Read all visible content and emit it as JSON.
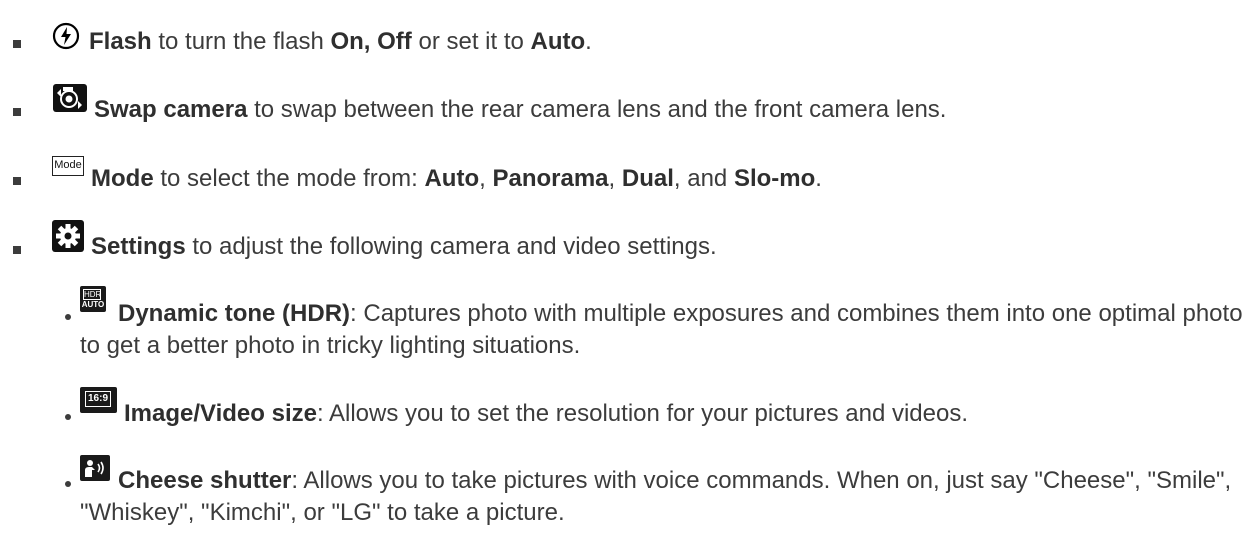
{
  "items": [
    {
      "icon": "flash-icon",
      "segments": [
        {
          "t": "Flash",
          "b": true
        },
        {
          "t": " to turn the flash ",
          "b": false
        },
        {
          "t": "On, Off",
          "b": true
        },
        {
          "t": " or set it to ",
          "b": false
        },
        {
          "t": "Auto",
          "b": true
        },
        {
          "t": ".",
          "b": false
        }
      ]
    },
    {
      "icon": "swap-camera-icon",
      "segments": [
        {
          "t": "Swap camera",
          "b": true
        },
        {
          "t": " to swap between the rear camera lens and the front camera lens.",
          "b": false
        }
      ]
    },
    {
      "icon": "mode-icon",
      "icon_label": "Mode",
      "segments": [
        {
          "t": "Mode",
          "b": true
        },
        {
          "t": " to select the mode from: ",
          "b": false
        },
        {
          "t": "Auto",
          "b": true
        },
        {
          "t": ", ",
          "b": false
        },
        {
          "t": "Panorama",
          "b": true
        },
        {
          "t": ", ",
          "b": false
        },
        {
          "t": "Dual",
          "b": true
        },
        {
          "t": ", and ",
          "b": false
        },
        {
          "t": "Slo-mo",
          "b": true
        },
        {
          "t": ".",
          "b": false
        }
      ]
    },
    {
      "icon": "gear-icon",
      "segments": [
        {
          "t": "Settings",
          "b": true
        },
        {
          "t": " to adjust the following camera and video settings.",
          "b": false
        }
      ]
    }
  ],
  "subitems": [
    {
      "icon": "hdr-auto-icon",
      "icon_label_top": "HDR",
      "icon_label_bottom": "AUTO",
      "segments": [
        {
          "t": "Dynamic tone (HDR)",
          "b": true
        },
        {
          "t": ": Captures photo with multiple exposures and combines them into one optimal photo to get a better photo in tricky lighting situations.",
          "b": false
        }
      ]
    },
    {
      "icon": "image-size-icon",
      "icon_label": "16:9",
      "segments": [
        {
          "t": "Image/Video size",
          "b": true
        },
        {
          "t": ": Allows you to set the resolution for your pictures and videos.",
          "b": false
        }
      ]
    },
    {
      "icon": "cheese-shutter-icon",
      "segments": [
        {
          "t": "Cheese shutter",
          "b": true
        },
        {
          "t": ": Allows you to take pictures with voice commands. When on, just say \"Cheese\", \"Smile\", \"Whiskey\", \"Kimchi\", or \"LG\" to take a picture.",
          "b": false
        }
      ]
    }
  ]
}
